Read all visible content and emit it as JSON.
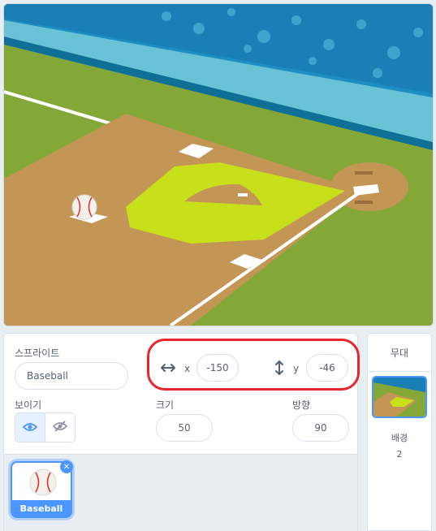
{
  "sprite_panel": {
    "sprite_label": "스프라이트",
    "sprite_name": "Baseball",
    "x_label": "x",
    "x_value": "-150",
    "y_label": "y",
    "y_value": "-46",
    "show_label": "보이기",
    "size_label": "크기",
    "size_value": "50",
    "direction_label": "방향",
    "direction_value": "90",
    "visible": true
  },
  "sprite_list": {
    "items": [
      {
        "name": "Baseball",
        "selected": true,
        "icon": "baseball-icon"
      }
    ]
  },
  "stage_panel": {
    "title": "무대",
    "backdrops_label": "배경",
    "backdrops_count": "2"
  },
  "colors": {
    "accent": "#4c97ff",
    "highlight_ring": "#e8262d",
    "grass": "#7fa33a",
    "dirt": "#c39656",
    "infield_grass": "#c8e01a"
  },
  "icons": {
    "x_axis": "horizontal-arrows-icon",
    "y_axis": "vertical-arrows-icon",
    "show": "eye-icon",
    "hide": "eye-slash-icon",
    "delete": "close-icon"
  }
}
